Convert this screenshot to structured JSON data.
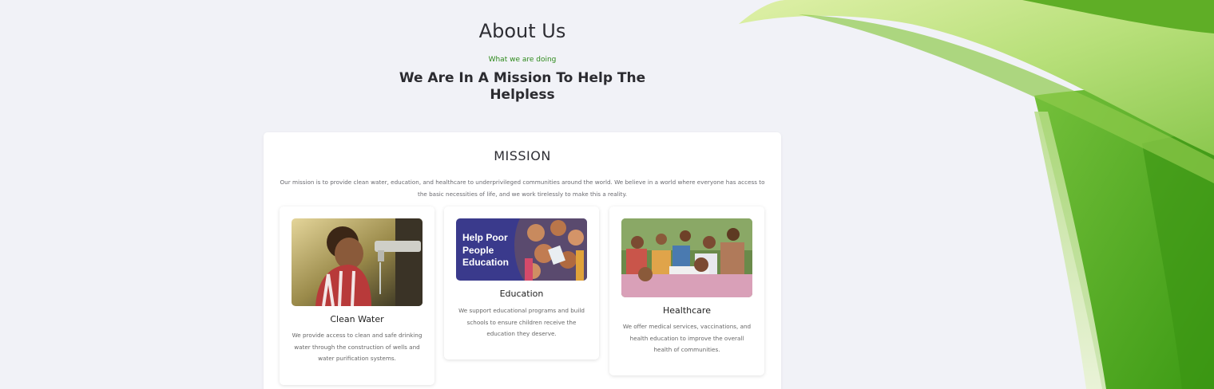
{
  "header": {
    "title": "About Us",
    "kicker": "What we are doing",
    "headline": "We Are In A Mission To Help The Helpless"
  },
  "mission": {
    "title": "MISSION",
    "text": "Our mission is to provide clean water, education, and healthcare to underprivileged communities around the world. We believe in a world where everyone has access to the basic necessities of life, and we work tirelessly to make this a reality."
  },
  "cards": [
    {
      "name": "Clean Water",
      "description": "We provide access to clean and safe drinking water through the construction of wells and water purification systems."
    },
    {
      "name": "Education",
      "image_text": "Help Poor People Education",
      "description": "We support educational programs and build schools to ensure children receive the education they deserve."
    },
    {
      "name": "Healthcare",
      "description": "We offer medical services, vaccinations, and health education to improve the overall health of communities."
    }
  ],
  "colors": {
    "background": "#f1f2f7",
    "accent_green": "#2e8a1c",
    "leaf_green": "#4aa51f",
    "education_banner": "#3a3a8c"
  }
}
